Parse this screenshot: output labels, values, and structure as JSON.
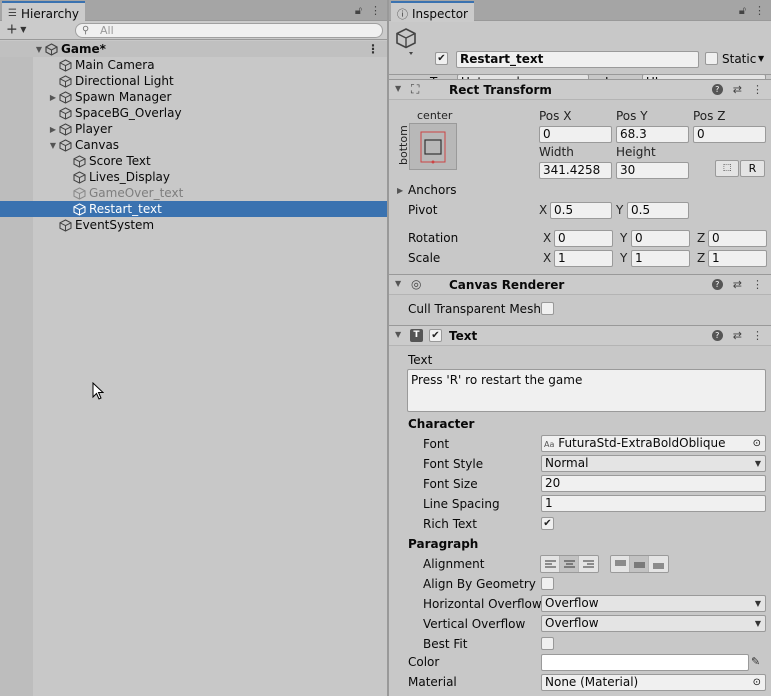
{
  "hierarchy": {
    "tab_label": "Hierarchy",
    "search_placeholder": "All",
    "scene_name": "Game*",
    "items": [
      {
        "label": "Main Camera",
        "depth": 1,
        "expandable": false
      },
      {
        "label": "Directional Light",
        "depth": 1,
        "expandable": false
      },
      {
        "label": "Spawn Manager",
        "depth": 1,
        "expandable": true,
        "expanded": false
      },
      {
        "label": "SpaceBG_Overlay",
        "depth": 1,
        "expandable": false
      },
      {
        "label": "Player",
        "depth": 1,
        "expandable": true,
        "expanded": false
      },
      {
        "label": "Canvas",
        "depth": 1,
        "expandable": true,
        "expanded": true
      },
      {
        "label": "Score Text",
        "depth": 2,
        "expandable": false
      },
      {
        "label": "Lives_Display",
        "depth": 2,
        "expandable": false
      },
      {
        "label": "GameOver_text",
        "depth": 2,
        "expandable": false,
        "disabled": true
      },
      {
        "label": "Restart_text",
        "depth": 2,
        "expandable": false,
        "selected": true
      },
      {
        "label": "EventSystem",
        "depth": 1,
        "expandable": false
      }
    ]
  },
  "inspector": {
    "tab_label": "Inspector",
    "object_name": "Restart_text",
    "static_label": "Static",
    "tag_label": "Tag",
    "tag_value": "Untagged",
    "layer_label": "Layer",
    "layer_value": "UI",
    "rect_transform": {
      "title": "Rect Transform",
      "anchor_preset_top": "center",
      "anchor_preset_side": "bottom",
      "pos_x_label": "Pos X",
      "pos_x": "0",
      "pos_y_label": "Pos Y",
      "pos_y": "68.3",
      "pos_z_label": "Pos Z",
      "pos_z": "0",
      "width_label": "Width",
      "width": "341.4258",
      "height_label": "Height",
      "height": "30",
      "r_button": "R",
      "anchors_label": "Anchors",
      "pivot_label": "Pivot",
      "pivot_x": "0.5",
      "pivot_y": "0.5",
      "rotation_label": "Rotation",
      "rot_x": "0",
      "rot_y": "0",
      "rot_z": "0",
      "scale_label": "Scale",
      "scale_x": "1",
      "scale_y": "1",
      "scale_z": "1",
      "x": "X",
      "y": "Y",
      "z": "Z"
    },
    "canvas_renderer": {
      "title": "Canvas Renderer",
      "cull_label": "Cull Transparent Mesh"
    },
    "text": {
      "title": "Text",
      "text_label": "Text",
      "text_value": "Press 'R' ro restart the game",
      "character_title": "Character",
      "font_label": "Font",
      "font_value": "FuturaStd-ExtraBoldOblique",
      "font_style_label": "Font Style",
      "font_style_value": "Normal",
      "font_size_label": "Font Size",
      "font_size_value": "20",
      "line_spacing_label": "Line Spacing",
      "line_spacing_value": "1",
      "rich_text_label": "Rich Text",
      "paragraph_title": "Paragraph",
      "alignment_label": "Alignment",
      "align_geom_label": "Align By Geometry",
      "h_overflow_label": "Horizontal Overflow",
      "h_overflow_value": "Overflow",
      "v_overflow_label": "Vertical Overflow",
      "v_overflow_value": "Overflow",
      "best_fit_label": "Best Fit",
      "color_label": "Color",
      "material_label": "Material",
      "material_value": "None (Material)"
    }
  },
  "colors": {
    "selection": "#3a72b0",
    "panel": "#c8c8c8"
  }
}
